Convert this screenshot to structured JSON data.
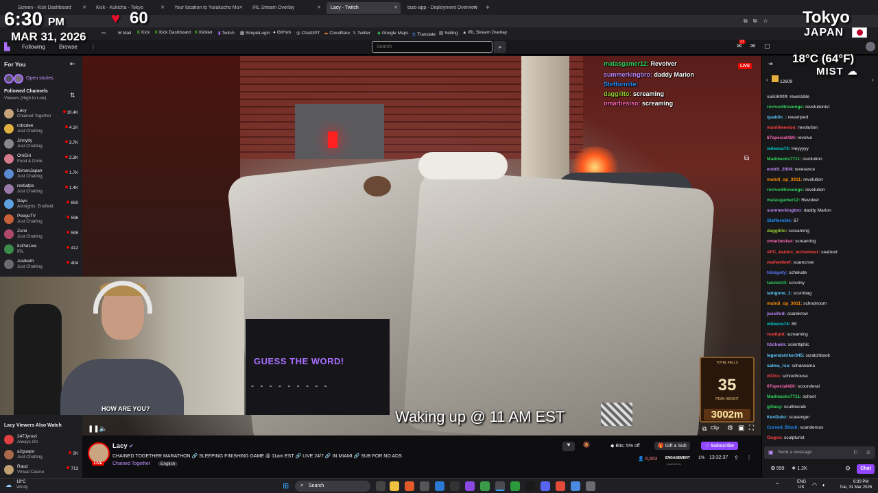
{
  "browser": {
    "tabs": [
      "Screen - Kick Dashboard",
      "Kick - Kukicha - Tokyo",
      "Your location to Yurakucho Mu",
      "IRL Stream Overlay",
      "Lacy - Twitch",
      "tazo-app - Deployment Overview"
    ],
    "new_tab": "+",
    "bookmarks": [
      "Mail",
      "Kick",
      "Kick Dashboard",
      "Kicklet",
      "Twitch",
      "SimpleLogin",
      "GitHub",
      "ChatGPT",
      "Cloudflare",
      "Twitter",
      "Google Maps",
      "Translate",
      "Selling",
      "IRL Stream Overlay"
    ]
  },
  "nav": {
    "following": "Following",
    "browse": "Browse",
    "search_placeholder": "Search",
    "notif_count": "21",
    "bits_label": "Bits: 5% off"
  },
  "sidebar": {
    "for_you": "For You",
    "open_stories": "Open stories",
    "followed_header": "Followed Channels",
    "sort_label": "Viewers (High to Low)",
    "channels": [
      {
        "name": "Lacy",
        "game": "Chained Together",
        "viewers": "10.4K"
      },
      {
        "name": "robcdee",
        "game": "Just Chatting",
        "viewers": "4.1K"
      },
      {
        "name": "Jinnytty",
        "game": "Just Chatting",
        "viewers": "3.7K"
      },
      {
        "name": "OniGiri",
        "game": "Food & Drink",
        "viewers": "2.3K"
      },
      {
        "name": "DimanJapan",
        "game": "Just Chatting",
        "viewers": "1.7K"
      },
      {
        "name": "restiafps",
        "game": "Just Chatting",
        "viewers": "1.4K"
      },
      {
        "name": "Sayu",
        "game": "Arknights: Endfield",
        "viewers": "650"
      },
      {
        "name": "PeeguTV",
        "game": "Just Chatting",
        "viewers": "596"
      },
      {
        "name": "Zumi",
        "game": "Just Chatting",
        "viewers": "595"
      },
      {
        "name": "ItsPatLive",
        "game": "IRL",
        "viewers": "412"
      },
      {
        "name": "Justketh",
        "game": "Just Chatting",
        "viewers": "404"
      }
    ],
    "also_watch_header": "Lacy Viewers Also Watch",
    "also_watch": [
      {
        "name": "247Jynxzi",
        "game": "Always On",
        "viewers": ""
      },
      {
        "name": "a2guapo",
        "game": "Just Chatting",
        "viewers": "2K"
      },
      {
        "name": "Raud",
        "game": "Virtual Casino",
        "viewers": "713"
      }
    ]
  },
  "overlay": {
    "time": "6:30",
    "ampm": "PM",
    "date": "MAR 31, 2026",
    "heart_rate": "60",
    "city": "Tokyo",
    "country": "JAPAN",
    "temperature": "18°C (64°F)",
    "weather": "MIST"
  },
  "player": {
    "live_badge": "LIVE",
    "video_chat": [
      {
        "user": "matasgamer12:",
        "msg": "Revolver",
        "color": "#2ed35a"
      },
      {
        "user": "summerkingbro:",
        "msg": "daddy Marion",
        "color": "#c08bff"
      },
      {
        "user": "Stefforniite:",
        "msg": "",
        "color": "#1e90ff"
      },
      {
        "user": "daggilito:",
        "msg": "screaming",
        "color": "#9acd32"
      },
      {
        "user": "omarbesiso:",
        "msg": "screaming",
        "color": "#ff69b4"
      }
    ],
    "guess_title": "GUESS THE WORD!",
    "guess_dashes": "- - - - - - - - -",
    "caption": "Waking up @ 11 AM EST",
    "counter_header": "TOTAL FALLS",
    "counter_value": "35",
    "counter_sub": "PEAK HEIGHT",
    "altitude": "3002m",
    "webcam_text": "HOW ARE YOU?",
    "clip_label": "Clip"
  },
  "stream_info": {
    "streamer": "Lacy",
    "title": "CHAINED TOGETHER MARATHON 🔗 SLEEPING FINISHING GAME @ 11am EST 🔗 LIVE 24/7 🔗 IN MIAMI 🔗 SUB FOR NO ADS",
    "category": "Chained Together",
    "tag": "English",
    "live": "LIVE",
    "bits": "Bits: 5% off",
    "gift_sub": "Gift a Sub",
    "subscribe": "Subscribe",
    "viewers": "6,653",
    "uptime": "13:32:37",
    "engagement_label": "ENGAGEMENT",
    "engagement_value": "1%",
    "powered_by": "powered by"
  },
  "chat": {
    "top_counter": "12609",
    "messages": [
      {
        "user": "saiki6009:",
        "msg": "reversible",
        "color": "#adadb8"
      },
      {
        "user": "revived4revenge:",
        "msg": "revolutionist",
        "color": "#2ed35a"
      },
      {
        "user": "quaklin_:",
        "msg": "revamped",
        "color": "#5cc9ff"
      },
      {
        "user": "manlikeeelso:",
        "msg": "revolution",
        "color": "#ff4040"
      },
      {
        "user": "67special420:",
        "msg": "revolve",
        "color": "#ff69b4"
      },
      {
        "user": "mileena74:",
        "msg": "Heyyyyy",
        "color": "#00c8c8"
      },
      {
        "user": "Madmacks7711:",
        "msg": "revolution",
        "color": "#2ed35a"
      },
      {
        "user": "endrit_2004:",
        "msg": "reverance",
        "color": "#c08bff"
      },
      {
        "user": "mahdi_op_3611:",
        "msg": "revolution",
        "color": "#ff8c00"
      },
      {
        "user": "revived4revenge:",
        "msg": "revolution",
        "color": "#2ed35a"
      },
      {
        "user": "matasgamer12:",
        "msg": "Revolver",
        "color": "#2ed35a"
      },
      {
        "user": "summerkingbro:",
        "msg": "daddy Marion",
        "color": "#c08bff"
      },
      {
        "user": "Stefforniite:",
        "msg": "67",
        "color": "#1e90ff"
      },
      {
        "user": "daggilito:",
        "msg": "screaming",
        "color": "#9acd32"
      },
      {
        "user": "omarbesiso:",
        "msg": "screaming",
        "color": "#ff69b4"
      },
      {
        "user": "AFC_kaidox_lechomeur:",
        "msg": "seafood",
        "color": "#ff4040"
      },
      {
        "user": "wwfewfwef:",
        "msg": "scarecrow",
        "color": "#ff4040"
      },
      {
        "user": "triksgoty:",
        "msg": "schelude",
        "color": "#5c7cff"
      },
      {
        "user": "tanzim33:",
        "msg": "scrutiny",
        "color": "#2ed35a"
      },
      {
        "user": "iamgone_1:",
        "msg": "scumbag",
        "color": "#5cc9ff"
      },
      {
        "user": "mahdi_op_3611:",
        "msg": "schoolroom",
        "color": "#ff8c00"
      },
      {
        "user": "jussihrd:",
        "msg": "scarekrow",
        "color": "#c08bff"
      },
      {
        "user": "mileena74:",
        "msg": "69",
        "color": "#00c8c8"
      },
      {
        "user": "noellpld:",
        "msg": "screaming",
        "color": "#ff4040"
      },
      {
        "user": "h1chaim:",
        "msg": "scientiphic",
        "color": "#c08bff"
      },
      {
        "user": "legendstriker345:",
        "msg": "scratchbook",
        "color": "#5cc9ff"
      },
      {
        "user": "salma_rss:",
        "msg": "scharwama",
        "color": "#5cc9ff"
      },
      {
        "user": "d33ss:",
        "msg": "schoolhouse",
        "color": "#ff4040"
      },
      {
        "user": "67special420:",
        "msg": "scounderal",
        "color": "#ff69b4"
      },
      {
        "user": "Madmacks7711:",
        "msg": "school",
        "color": "#2ed35a"
      },
      {
        "user": "glitasy:",
        "msg": "scuttlecrab",
        "color": "#2ed35a"
      },
      {
        "user": "KevDubz:",
        "msg": "scavenger",
        "color": "#5cc9ff"
      },
      {
        "user": "Curved_Block:",
        "msg": "scanderous",
        "color": "#1e90ff"
      },
      {
        "user": "Oogos:",
        "msg": "sculpturist",
        "color": "#ff4040"
      }
    ],
    "input_placeholder": "Send a message",
    "points": "599",
    "bits_count": "1.2K",
    "chat_button": "Chat"
  },
  "taskbar": {
    "weather_temp": "18°C",
    "weather_desc": "Windy",
    "search": "Search",
    "lang1": "ENG",
    "lang2": "US",
    "time": "6:30 PM",
    "date": "Tue, 31 Mar 2026"
  }
}
